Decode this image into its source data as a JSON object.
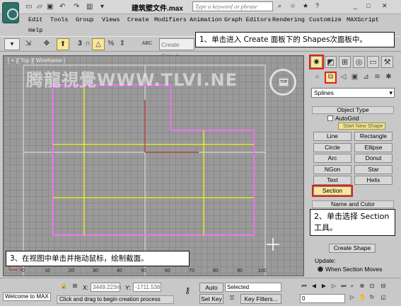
{
  "titlebar": {
    "doc_title": "建筑壁文件.max",
    "search_placeholder": "Type a keyword or phrase"
  },
  "menubar": [
    {
      "label": "Edit"
    },
    {
      "label": "Tools"
    },
    {
      "label": "Group"
    },
    {
      "label": "Views"
    },
    {
      "label": "Create"
    },
    {
      "label": "Modifiers"
    },
    {
      "label": "Animation"
    },
    {
      "label": "Graph Editors"
    },
    {
      "label": "Rendering"
    },
    {
      "label": "Customize"
    },
    {
      "label": "MAXScript"
    },
    {
      "label": "Help"
    }
  ],
  "toolbar": {
    "create_selection_placeholder": "Create Selecti",
    "snap_value": "3",
    "abc_label": "ABC"
  },
  "callouts": {
    "step1": "1、单击进入 Create 面板下的 Shapes次面板中。",
    "step2": "2、单击选择 Section 工具。",
    "step3": "3、在视图中单击并拖动鼠标，绘制截面。"
  },
  "viewport": {
    "label": "[ + ][ Top ][ Wireframe ]",
    "watermark": "腾龍視覺WWW.TLVI.NE",
    "viewcube_label": "TOP",
    "ruler_ticks": [
      "0",
      "10",
      "20",
      "30",
      "40",
      "50",
      "60",
      "70",
      "80",
      "90",
      "100"
    ],
    "axes": [
      "X",
      "Y"
    ]
  },
  "command_panel": {
    "category": "Splines",
    "object_type_header": "Object Type",
    "autogrid_label": "AutoGrid",
    "start_new_shape_label": "Start New Shape",
    "buttons": [
      "Line",
      "Rectangle",
      "Circle",
      "Ellipse",
      "Arc",
      "Donut",
      "NGon",
      "Star",
      "Text",
      "Helix",
      "Section"
    ],
    "selected_button": "Section",
    "name_color_header": "Name and Color",
    "create_shape_label": "Create Shape",
    "update_label": "Update:",
    "update_option": "When Section Moves"
  },
  "statusbar": {
    "welcome": "Welcome to MAX",
    "x_label": "X:",
    "x_value": "3449.223m",
    "y_label": "Y:",
    "y_value": "-1711.536",
    "autokey_label": "Auto Key",
    "selected_value": "Selected",
    "setkey_label": "Set Key",
    "keyfilters_label": "Key Filters...",
    "prompt": "Click and drag to begin creation process",
    "frame_value": "0"
  },
  "colors": {
    "highlight_red": "#e0201a",
    "selected_yellow": "#f6e79a",
    "shape_magenta": "#f070f0",
    "shape_yellow": "#e8e820"
  }
}
